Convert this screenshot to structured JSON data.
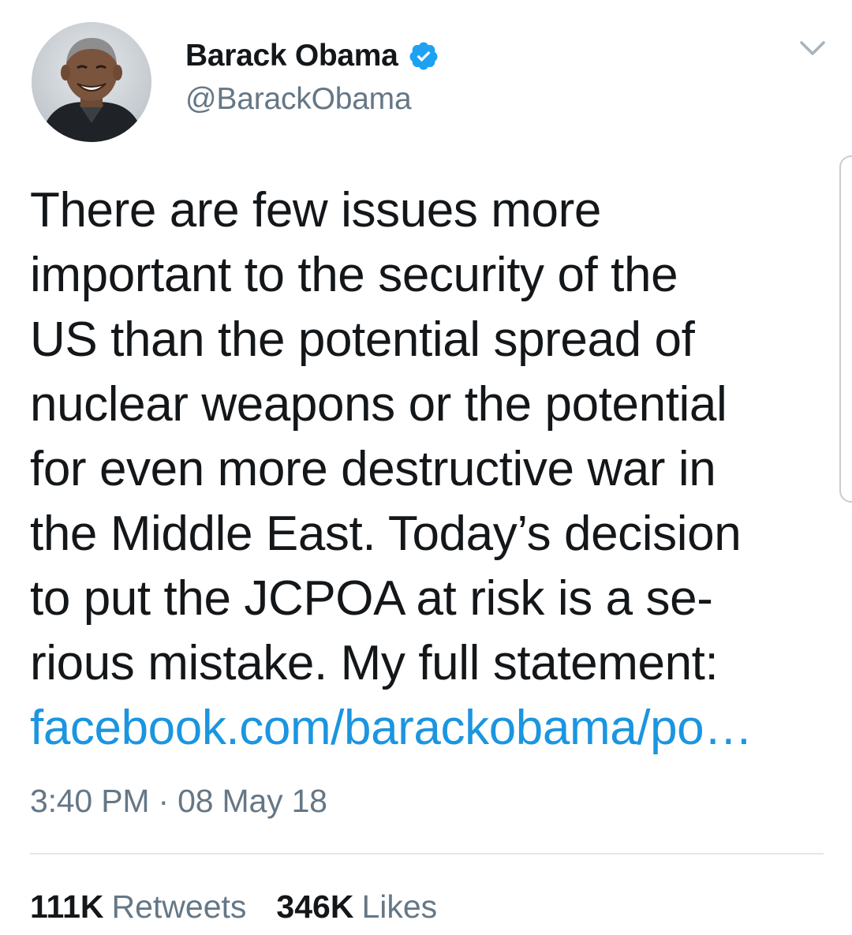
{
  "author": {
    "display_name": "Barack Obama",
    "handle": "@BarackObama",
    "verified": true,
    "verified_icon": "verified-badge-icon",
    "avatar_icon": "profile-photo"
  },
  "tweet": {
    "text_lines": [
      "There are few issues more",
      "important to the security of the",
      "US than the potential spread of",
      "nuclear weapons or the potential",
      "for even more destructive war in",
      "the Middle East. Today’s decision",
      "to put the JCPOA at risk is a se-",
      "rious mistake. My full statement:"
    ],
    "link_text": "facebook.com/barackobama/po…",
    "timestamp": "3:40 PM · 08 May 18"
  },
  "stats": {
    "retweets_count": "111K",
    "retweets_label": "Retweets",
    "likes_count": "346K",
    "likes_label": "Likes"
  },
  "menu": {
    "caret_icon": "chevron-down-icon"
  },
  "colors": {
    "link": "#1b95e0",
    "verified": "#1da1f2",
    "secondary_text": "#657786",
    "primary_text": "#14171a",
    "divider": "#e1e8ed"
  }
}
